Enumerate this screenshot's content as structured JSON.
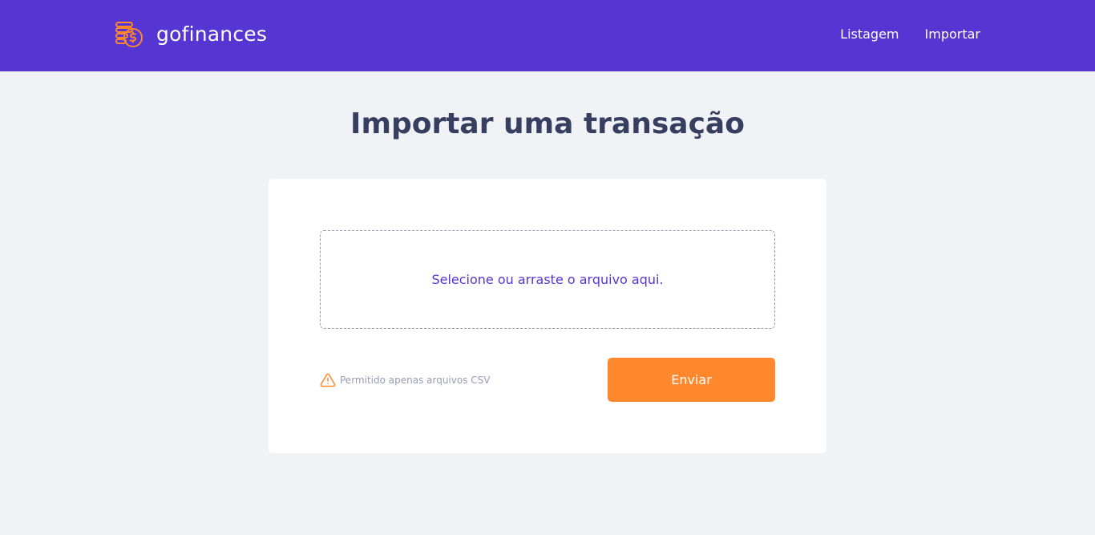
{
  "header": {
    "brand_name": "gofinances",
    "logo_icon": "coins-dollar-icon",
    "nav": {
      "listagem": "Listagem",
      "importar": "Importar"
    }
  },
  "main": {
    "title": "Importar uma transação",
    "dropzone_text": "Selecione ou arraste o arquivo aqui.",
    "notice_icon": "alert-triangle-icon",
    "notice_text": "Permitido apenas arquivos CSV",
    "send_label": "Enviar"
  },
  "colors": {
    "header_bg": "#5636D3",
    "page_bg": "#F0F2F5",
    "title": "#363F5F",
    "accent_orange": "#FF872C",
    "muted": "#969CB3"
  }
}
